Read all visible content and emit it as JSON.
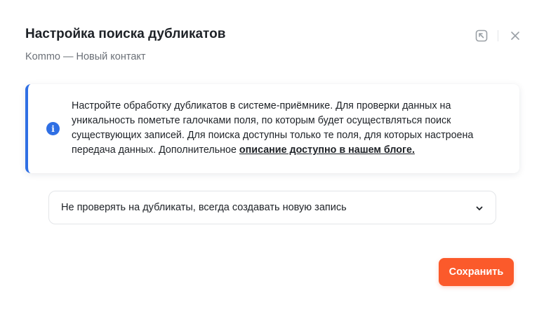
{
  "header": {
    "title": "Настройка поиска дубликатов",
    "subtitle": "Kommo — Новый контакт",
    "icons": [
      "collapse-window-icon",
      "close-icon"
    ]
  },
  "info": {
    "icon": "info-icon",
    "text": "Настройте обработку дубликатов в системе-приёмнике. Для проверки данных на уникальность пометьте галочками поля, по которым будет осуществляться поиск существующих записей. Для поиска доступны только те поля, для которых настроена передача данных. Дополнительное ",
    "link_text": "описание доступно в нашем блоге.",
    "accent_color": "#2f6fe4"
  },
  "duplicate_mode": {
    "selected": "Не проверять на дубликаты, всегда создавать новую запись",
    "icon": "chevron-down-icon"
  },
  "actions": {
    "save_label": "Сохранить",
    "save_color": "#fb5a2b"
  }
}
